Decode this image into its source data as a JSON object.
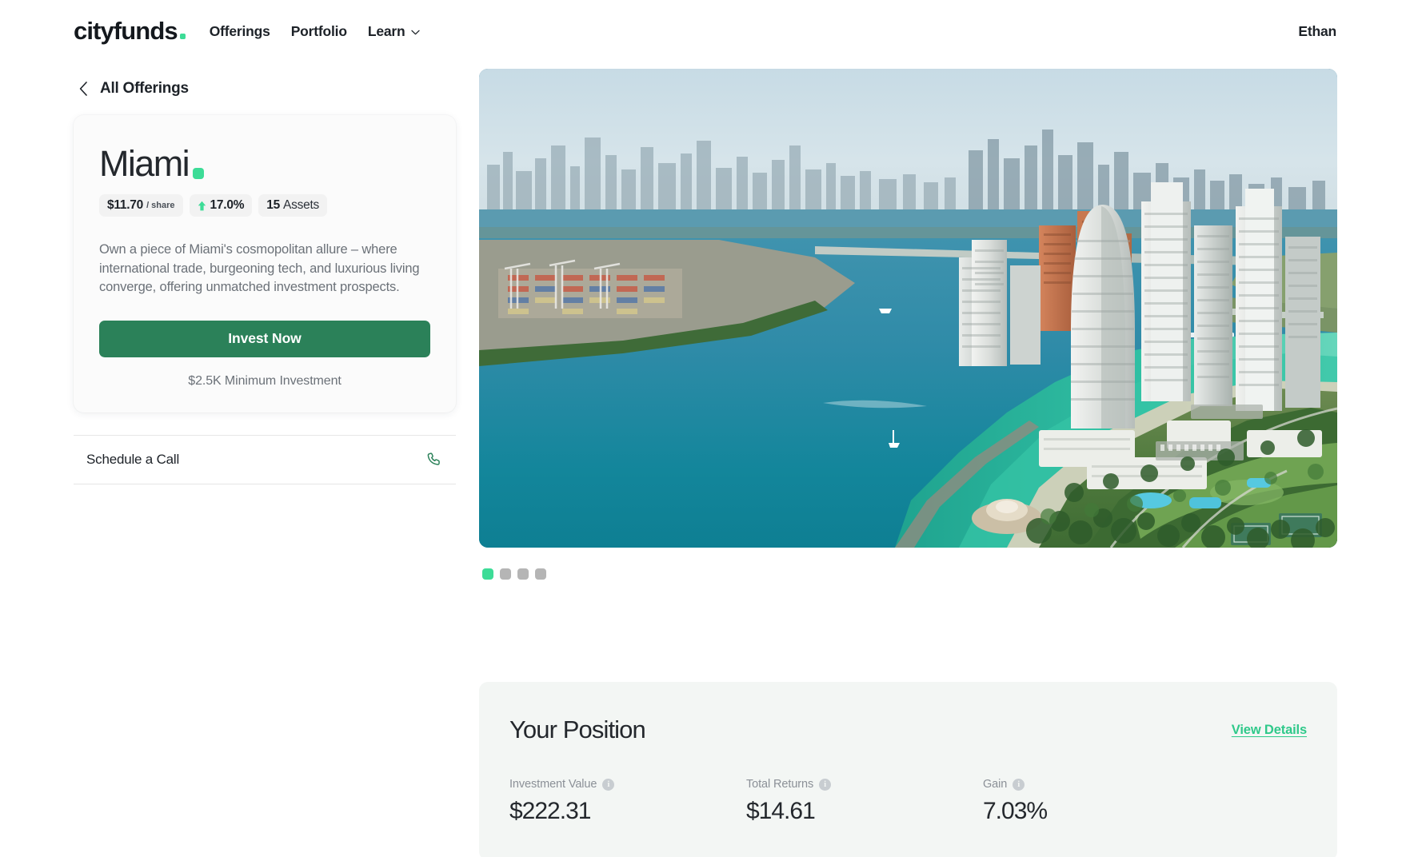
{
  "nav": {
    "brand": "cityfunds",
    "links": [
      {
        "label": "Offerings",
        "has_caret": false
      },
      {
        "label": "Portfolio",
        "has_caret": false
      },
      {
        "label": "Learn",
        "has_caret": true
      }
    ],
    "account": "Ethan"
  },
  "back": {
    "label": "All Offerings",
    "icon": "chevron-left-icon"
  },
  "offering": {
    "city": "Miami",
    "pills": [
      {
        "value": "$11.70",
        "suffix": "/ share",
        "type": "price"
      },
      {
        "value": "17.0%",
        "type": "change",
        "direction": "up",
        "arrow_color": "#3ddc97"
      },
      {
        "value": "15",
        "suffix": "Assets",
        "type": "count"
      }
    ],
    "description": "Own a piece of Miami's cosmopolitan allure – where international trade, burgeoning tech, and luxurious living converge, offering unmatched investment prospects.",
    "invest_button": "Invest Now",
    "minimum": "$2.5K Minimum Investment",
    "accent_color": "#3ddc97",
    "button_color": "#2b8159"
  },
  "schedule_call": {
    "label": "Schedule a Call",
    "icon": "phone-icon",
    "icon_color": "#2b8159"
  },
  "carousel": {
    "slides": 4,
    "active_index": 0,
    "image_alt": "Aerial view of Miami Beach waterfront with high-rise towers, marina and turquoise ocean"
  },
  "position": {
    "title": "Your Position",
    "view_details": "View Details",
    "metrics": [
      {
        "label": "Investment Value",
        "value": "$222.31",
        "info": "i"
      },
      {
        "label": "Total Returns",
        "value": "$14.61",
        "info": "i"
      },
      {
        "label": "Gain",
        "value": "7.03%",
        "info": "i"
      }
    ]
  }
}
